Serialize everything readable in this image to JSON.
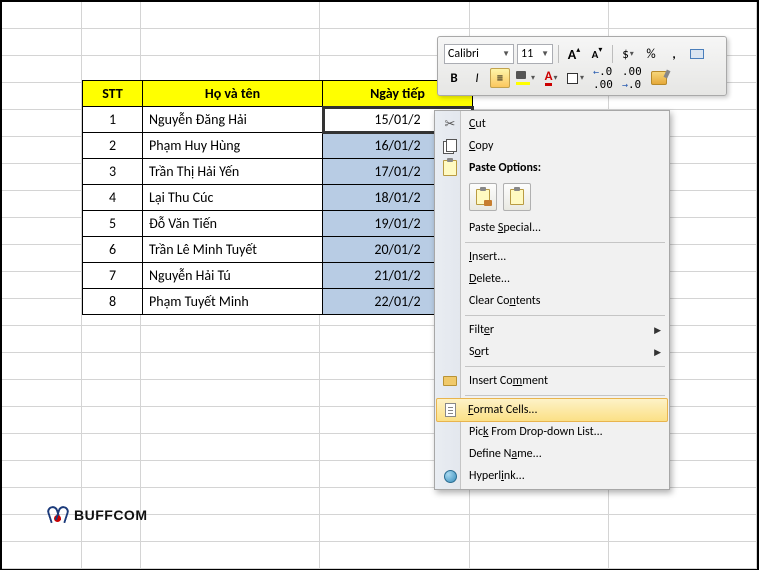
{
  "table": {
    "headers": {
      "stt": "STT",
      "name": "Họ và tên",
      "date1": "Ngày tiếp",
      "date2": ""
    },
    "rows": [
      {
        "stt": "1",
        "name": "Nguyễn Đăng Hải",
        "date1": "15/01/2"
      },
      {
        "stt": "2",
        "name": "Phạm Huy Hùng",
        "date1": "16/01/2"
      },
      {
        "stt": "3",
        "name": "Trần Thị Hải Yến",
        "date1": "17/01/2"
      },
      {
        "stt": "4",
        "name": "Lại Thu Cúc",
        "date1": "18/01/2"
      },
      {
        "stt": "5",
        "name": "Đỗ Văn Tiến",
        "date1": "19/01/2"
      },
      {
        "stt": "6",
        "name": "Trần Lê Minh Tuyết",
        "date1": "20/01/2"
      },
      {
        "stt": "7",
        "name": "Nguyễn Hải Tú",
        "date1": "21/01/2"
      },
      {
        "stt": "8",
        "name": "Phạm Tuyết Minh",
        "date1": "22/01/2"
      }
    ]
  },
  "mini_toolbar": {
    "font_name": "Calibri",
    "font_size": "11",
    "bold": "B",
    "italic": "I",
    "big_a": "A",
    "small_a": "A",
    "currency": "$",
    "percent": "%",
    "comma": ",",
    "font_color_a": "A",
    "highlight_a": "A",
    "dec_inc": ".0 .00",
    "dec_dec": ".00 .0"
  },
  "context_menu": {
    "cut": "Cut",
    "copy": "Copy",
    "paste_options": "Paste Options:",
    "paste_special": "Paste Special...",
    "insert": "Insert...",
    "delete": "Delete...",
    "clear_contents": "Clear Contents",
    "filter": "Filter",
    "sort": "Sort",
    "insert_comment": "Insert Comment",
    "format_cells": "Format Cells...",
    "pick_list": "Pick From Drop-down List...",
    "define_name": "Define Name...",
    "hyperlink": "Hyperlink..."
  },
  "logo_text": "BUFFCOM",
  "colors": {
    "header_bg": "#ffff00",
    "selection_bg": "#b8cce4"
  }
}
